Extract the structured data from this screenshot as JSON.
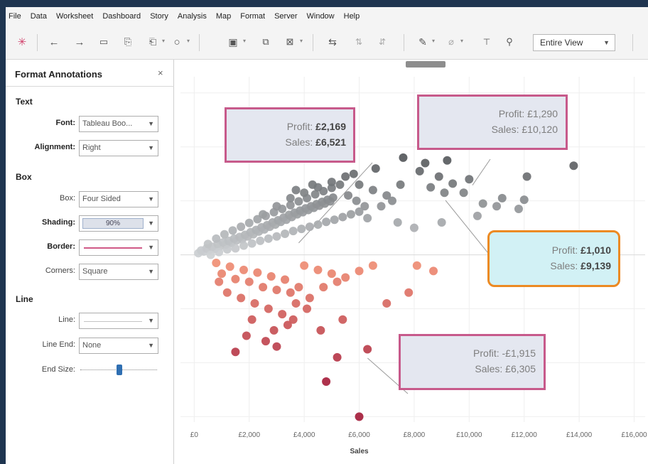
{
  "menu": [
    "File",
    "Data",
    "Worksheet",
    "Dashboard",
    "Story",
    "Analysis",
    "Map",
    "Format",
    "Server",
    "Window",
    "Help"
  ],
  "toolbar": {
    "view_select": "Entire View",
    "icons": [
      "tableau-logo-icon",
      "back-arrow-icon",
      "forward-arrow-icon",
      "save-icon",
      "add-datasource-icon",
      "extract-icon",
      "refresh-icon",
      "new-worksheet-icon",
      "duplicate-icon",
      "clear-sheet-icon",
      "swap-icon",
      "sort-ascending-icon",
      "sort-descending-icon",
      "highlight-icon",
      "group-icon",
      "label-icon",
      "pin-icon"
    ]
  },
  "panel": {
    "title": "Format Annotations",
    "close": "×",
    "sections": {
      "text": "Text",
      "box": "Box",
      "line": "Line"
    },
    "fields": {
      "font": {
        "label": "Font:",
        "value": "Tableau Boo..."
      },
      "alignment": {
        "label": "Alignment:",
        "value": "Right"
      },
      "box": {
        "label": "Box:",
        "value": "Four Sided"
      },
      "shading": {
        "label": "Shading:",
        "value": "90%"
      },
      "border": {
        "label": "Border:"
      },
      "corners": {
        "label": "Corners:",
        "value": "Square"
      },
      "line": {
        "label": "Line:"
      },
      "line_end": {
        "label": "Line End:",
        "value": "None"
      },
      "end_size": {
        "label": "End Size:",
        "level": 0.5
      }
    }
  },
  "colors": {
    "annotation_border": "#c75a8b",
    "annotation_fill": "#e4e7f0",
    "selected_border": "#ec8a23",
    "selected_fill": "#d2f1f5",
    "positive_mark": "#6f7378",
    "negative_mark": "#c4294a"
  },
  "annotations": [
    {
      "profit_label": "Profit:",
      "profit": "£2,169",
      "sales_label": "Sales:",
      "sales": "£6,521",
      "target_sales": 3800,
      "target_profit": 220
    },
    {
      "profit_label": "Profit:",
      "profit": "£1,290",
      "sales_label": "Sales:",
      "sales": "£10,120",
      "target_sales": 10120,
      "target_profit": 1290
    },
    {
      "profit_label": "Profit:",
      "profit": "£1,010",
      "sales_label": "Sales:",
      "sales": "£9,139",
      "target_sales": 9139,
      "target_profit": 1010
    },
    {
      "profit_label": "Profit:",
      "profit": "-£1,915",
      "sales_label": "Sales:",
      "sales": "£6,305",
      "target_sales": 6305,
      "target_profit": -1915
    }
  ],
  "chart_data": {
    "type": "scatter",
    "xlabel": "Sales",
    "ylabel": "",
    "x_ticks": [
      "£0",
      "£2,000",
      "£4,000",
      "£6,000",
      "£8,000",
      "£10,000",
      "£12,000",
      "£14,000",
      "£16,000"
    ],
    "x_tick_values": [
      0,
      2000,
      4000,
      6000,
      8000,
      10000,
      12000,
      14000,
      16000
    ],
    "xlim": [
      -500,
      16400
    ],
    "ylim": [
      -3100,
      3300
    ],
    "grid": true,
    "series": [
      {
        "points": [
          [
            150,
            30
          ],
          [
            250,
            80
          ],
          [
            350,
            60
          ],
          [
            450,
            120
          ],
          [
            550,
            90
          ],
          [
            650,
            150
          ],
          [
            750,
            110
          ],
          [
            850,
            200
          ],
          [
            950,
            160
          ],
          [
            1050,
            230
          ],
          [
            1150,
            190
          ],
          [
            1250,
            260
          ],
          [
            1350,
            220
          ],
          [
            1450,
            300
          ],
          [
            1550,
            270
          ],
          [
            1650,
            330
          ],
          [
            1750,
            290
          ],
          [
            1850,
            370
          ],
          [
            1950,
            340
          ],
          [
            2050,
            420
          ],
          [
            2150,
            380
          ],
          [
            2250,
            460
          ],
          [
            2350,
            430
          ],
          [
            2450,
            510
          ],
          [
            2550,
            470
          ],
          [
            2650,
            550
          ],
          [
            2750,
            520
          ],
          [
            2850,
            600
          ],
          [
            2950,
            560
          ],
          [
            3050,
            640
          ],
          [
            3150,
            610
          ],
          [
            3250,
            690
          ],
          [
            3350,
            650
          ],
          [
            3450,
            740
          ],
          [
            3550,
            700
          ],
          [
            3650,
            780
          ],
          [
            3750,
            750
          ],
          [
            3850,
            820
          ],
          [
            3950,
            790
          ],
          [
            4050,
            860
          ],
          [
            4150,
            830
          ],
          [
            4250,
            900
          ],
          [
            4350,
            870
          ],
          [
            4450,
            940
          ],
          [
            4550,
            910
          ],
          [
            4650,
            980
          ],
          [
            4750,
            950
          ],
          [
            4850,
            1020
          ],
          [
            4950,
            990
          ],
          [
            5050,
            1060
          ],
          [
            500,
            200
          ],
          [
            800,
            300
          ],
          [
            1100,
            380
          ],
          [
            1400,
            450
          ],
          [
            1700,
            520
          ],
          [
            2000,
            590
          ],
          [
            2300,
            660
          ],
          [
            2600,
            720
          ],
          [
            2900,
            790
          ],
          [
            3200,
            850
          ],
          [
            3500,
            920
          ],
          [
            3800,
            990
          ],
          [
            4100,
            1050
          ],
          [
            4400,
            1120
          ],
          [
            4700,
            1180
          ],
          [
            5000,
            1240
          ],
          [
            5300,
            1300
          ],
          [
            5600,
            1100
          ],
          [
            5900,
            1000
          ],
          [
            6200,
            900
          ],
          [
            600,
            0
          ],
          [
            900,
            50
          ],
          [
            1200,
            100
          ],
          [
            1500,
            120
          ],
          [
            1800,
            170
          ],
          [
            2100,
            210
          ],
          [
            2400,
            260
          ],
          [
            2700,
            300
          ],
          [
            3000,
            340
          ],
          [
            3300,
            390
          ],
          [
            3600,
            440
          ],
          [
            3900,
            480
          ],
          [
            4200,
            520
          ],
          [
            4500,
            560
          ],
          [
            4800,
            610
          ],
          [
            5100,
            650
          ],
          [
            5400,
            700
          ],
          [
            5700,
            750
          ],
          [
            6000,
            800
          ],
          [
            6300,
            680
          ],
          [
            2500,
            750
          ],
          [
            3000,
            900
          ],
          [
            3500,
            1050
          ],
          [
            4000,
            1150
          ],
          [
            4500,
            1250
          ],
          [
            5000,
            1350
          ],
          [
            5500,
            1450
          ],
          [
            6000,
            1300
          ],
          [
            6500,
            1200
          ],
          [
            7000,
            1100
          ],
          [
            6800,
            900
          ],
          [
            7200,
            1000
          ],
          [
            7500,
            1300
          ],
          [
            8200,
            1550
          ],
          [
            8600,
            1250
          ],
          [
            8900,
            1450
          ],
          [
            9100,
            1150
          ],
          [
            9400,
            1320
          ],
          [
            9800,
            1150
          ],
          [
            10500,
            950
          ],
          [
            11200,
            1050
          ],
          [
            11800,
            850
          ],
          [
            12000,
            1020
          ],
          [
            13800,
            1650
          ],
          [
            12100,
            1450
          ],
          [
            8400,
            1700
          ],
          [
            9200,
            1750
          ],
          [
            7600,
            1800
          ],
          [
            10000,
            1400
          ],
          [
            7400,
            600
          ],
          [
            8000,
            500
          ],
          [
            9000,
            600
          ],
          [
            10300,
            720
          ],
          [
            11000,
            900
          ],
          [
            6600,
            1600
          ],
          [
            5800,
            1500
          ],
          [
            4300,
            1300
          ],
          [
            3700,
            1200
          ]
        ]
      },
      {
        "points": [
          [
            800,
            -150
          ],
          [
            1300,
            -220
          ],
          [
            1800,
            -280
          ],
          [
            2300,
            -330
          ],
          [
            2800,
            -400
          ],
          [
            3300,
            -460
          ],
          [
            1000,
            -350
          ],
          [
            1500,
            -450
          ],
          [
            2000,
            -500
          ],
          [
            2500,
            -600
          ],
          [
            3000,
            -650
          ],
          [
            3500,
            -700
          ],
          [
            4000,
            -200
          ],
          [
            4500,
            -280
          ],
          [
            5000,
            -350
          ],
          [
            5500,
            -420
          ],
          [
            6000,
            -300
          ],
          [
            6500,
            -200
          ],
          [
            1200,
            -700
          ],
          [
            1700,
            -800
          ],
          [
            2200,
            -900
          ],
          [
            2700,
            -1000
          ],
          [
            3200,
            -1100
          ],
          [
            3700,
            -900
          ],
          [
            4200,
            -800
          ],
          [
            4700,
            -600
          ],
          [
            5200,
            -500
          ],
          [
            3400,
            -1300
          ],
          [
            2900,
            -1400
          ],
          [
            3600,
            -1200
          ],
          [
            4100,
            -1000
          ],
          [
            7000,
            -900
          ],
          [
            7800,
            -700
          ],
          [
            1900,
            -1500
          ],
          [
            2600,
            -1600
          ],
          [
            5400,
            -1200
          ],
          [
            4600,
            -1400
          ],
          [
            3000,
            -1700
          ],
          [
            1500,
            -1800
          ],
          [
            5200,
            -1900
          ],
          [
            6300,
            -1750
          ],
          [
            10900,
            -1550
          ],
          [
            4800,
            -2350
          ],
          [
            6000,
            -3000
          ],
          [
            8100,
            -200
          ],
          [
            8700,
            -300
          ],
          [
            900,
            -500
          ],
          [
            2100,
            -1200
          ],
          [
            3800,
            -600
          ]
        ]
      }
    ]
  }
}
